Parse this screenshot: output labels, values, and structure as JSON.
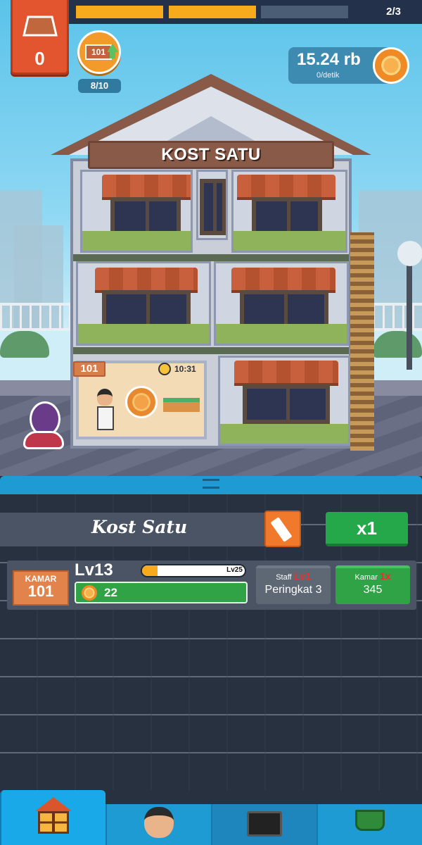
{
  "hud": {
    "block_count": "0",
    "stage_progress": "2/3",
    "stage_segments_filled": 2,
    "stage_segments_total": 3,
    "rank_tag": "101",
    "rank_count": "8/10",
    "money": "15.24 rb",
    "money_rate": "0/detik"
  },
  "scene": {
    "sign": "KOST SATU",
    "room_badge": "101",
    "room_timer": "10:31"
  },
  "panel": {
    "kost_name": "Kost Satu",
    "multiplier": "x1",
    "room": {
      "kamar_label": "KAMAR",
      "kamar_number": "101",
      "level": "Lv13",
      "level_max": "Lv25",
      "level_progress": 0.15,
      "income": "22",
      "staff_label": "Staff",
      "staff_level": "Lv1",
      "staff_value": "Peringkat 3",
      "kamar_btn_label": "Kamar",
      "kamar_btn_mult": "1x",
      "kamar_btn_value": "345"
    }
  },
  "tabs": {
    "active": "home",
    "items": [
      "home-icon",
      "staff-face-icon",
      "tv-icon",
      "shop-cart-icon"
    ]
  },
  "colors": {
    "accent_orange": "#f6aa1c",
    "panel_blue": "#1f9bd4",
    "green": "#2fa346",
    "red_block": "#e2552f"
  }
}
